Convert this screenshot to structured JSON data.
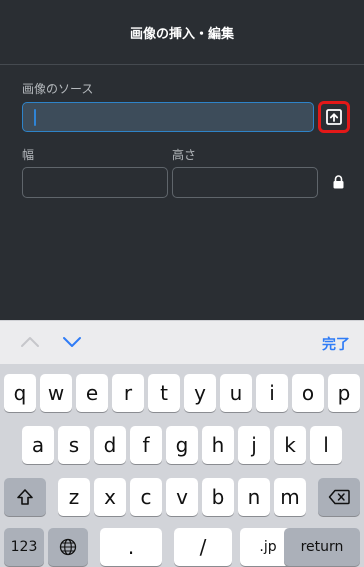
{
  "dialog": {
    "title": "画像の挿入・編集",
    "source_label": "画像のソース",
    "source_value": "",
    "width_label": "幅",
    "height_label": "高さ"
  },
  "accessory": {
    "done_label": "完了"
  },
  "keyboard": {
    "row1": [
      "q",
      "w",
      "e",
      "r",
      "t",
      "y",
      "u",
      "i",
      "o",
      "p"
    ],
    "row2": [
      "a",
      "s",
      "d",
      "f",
      "g",
      "h",
      "j",
      "k",
      "l"
    ],
    "row3": [
      "z",
      "x",
      "c",
      "v",
      "b",
      "n",
      "m"
    ],
    "numbers_label": "123",
    "dot_label": ".",
    "slash_label": "/",
    "jp_label": ".jp",
    "return_label": "return"
  },
  "colors": {
    "accent": "#2f7cf6",
    "highlight": "#e31818"
  }
}
